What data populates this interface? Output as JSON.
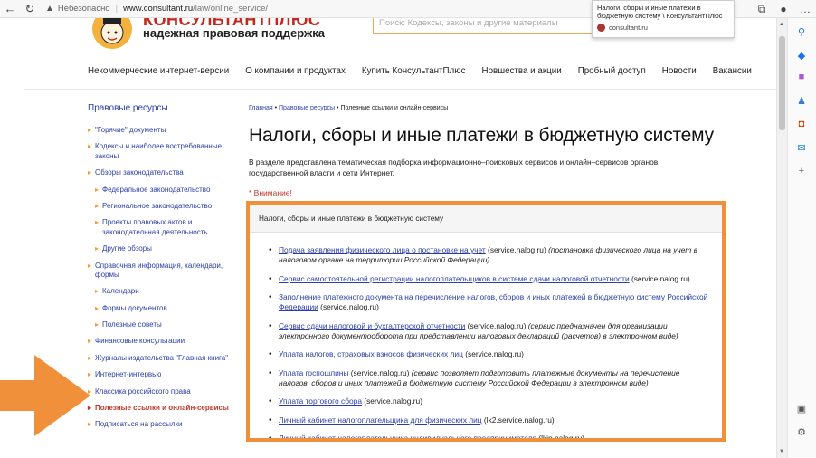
{
  "browser": {
    "insecure_label": "Небезопасно",
    "url_host": "www.consultant.ru",
    "url_path": "/law/online_service/",
    "tooltip_title": "Налоги, сборы и иные платежи в бюджетную систему \\ КонсультантПлюс",
    "tooltip_site": "consultant.ru"
  },
  "header": {
    "logo_title": "КОНСУЛЬТАНТПЛЮС",
    "logo_sub": "надежная правовая поддержка",
    "search_placeholder": "Поиск: Кодексы, законы и другие материалы"
  },
  "topnav": [
    "Некоммерческие интернет-версии",
    "О компании и продуктах",
    "Купить КонсультантПлюс",
    "Новшества и акции",
    "Пробный доступ",
    "Новости",
    "Вакансии"
  ],
  "sidebar": {
    "title": "Правовые ресурсы",
    "items": [
      {
        "label": "\"Горячие\" документы",
        "sub": false,
        "active": false
      },
      {
        "label": "Кодексы и наиболее востребованные законы",
        "sub": false,
        "active": false
      },
      {
        "label": "Обзоры законодательства",
        "sub": false,
        "active": false
      },
      {
        "label": "Федеральное законодательство",
        "sub": true,
        "active": false
      },
      {
        "label": "Региональное законодательство",
        "sub": true,
        "active": false
      },
      {
        "label": "Проекты правовых актов и законодательная деятельность",
        "sub": true,
        "active": false
      },
      {
        "label": "Другие обзоры",
        "sub": true,
        "active": false
      },
      {
        "label": "Справочная информация, календари, формы",
        "sub": false,
        "active": false
      },
      {
        "label": "Календари",
        "sub": true,
        "active": false
      },
      {
        "label": "Формы документов",
        "sub": true,
        "active": false
      },
      {
        "label": "Полезные советы",
        "sub": true,
        "active": false
      },
      {
        "label": "Финансовые консультации",
        "sub": false,
        "active": false
      },
      {
        "label": "Журналы издательства \"Главная книга\"",
        "sub": false,
        "active": false
      },
      {
        "label": "Интернет-интервью",
        "sub": false,
        "active": false
      },
      {
        "label": "Классика российского права",
        "sub": false,
        "active": false
      },
      {
        "label": "Полезные ссылки и онлайн-сервисы",
        "sub": false,
        "active": true
      },
      {
        "label": "Подписаться на рассылки",
        "sub": false,
        "active": false
      }
    ]
  },
  "content": {
    "crumb_home": "Главная",
    "crumb_resources": "Правовые ресурсы",
    "crumb_current": "Полезные ссылки и онлайн-сервисы",
    "title": "Налоги, сборы и иные платежи в бюджетную систему",
    "intro": "В разделе представлена тематическая подборка информационно–поисковых сервисов и онлайн–сервисов органов государственной власти и сети Интернет.",
    "attention": "* Внимание!",
    "box_title": "Налоги, сборы и иные платежи в бюджетную систему",
    "links": [
      {
        "link": "Подача заявления физического лица о постановке на учет",
        "plain": " (service.nalog.ru) ",
        "note": "(постановка физического лица на учет в налоговом органе на территории Российской Федерации)"
      },
      {
        "link": "Сервис самостоятельной регистрации налогоплательщиков в системе сдачи налоговой отчетности",
        "plain": " (service.nalog.ru)",
        "note": ""
      },
      {
        "link": "Заполнение платежного документа на перечисление налогов, сборов и иных платежей в бюджетную систему Российской Федерации",
        "plain": " (service.nalog.ru)",
        "note": ""
      },
      {
        "link": "Сервис сдачи налоговой и бухгалтерской отчетности",
        "plain": " (service.nalog.ru) ",
        "note": "(сервис предназначен для организации электронного документооборота при представлении налоговых деклараций (расчетов) в электронном виде)"
      },
      {
        "link": "Уплата налогов, страховых взносов физических лиц",
        "plain": " (service.nalog.ru)",
        "note": ""
      },
      {
        "link": "Уплата госпошлины",
        "plain": " (service.nalog.ru) ",
        "note": "(сервис позволяет подготовить платежные документы на перечисление налогов, сборов и иных платежей в бюджетную систему Российской Федерации в электронном виде)"
      },
      {
        "link": "Уплата торгового сбора",
        "plain": " (service.nalog.ru)",
        "note": ""
      },
      {
        "link": "Личный кабинет налогоплательщика для физических лиц",
        "plain": " (lk2.service.nalog.ru)",
        "note": ""
      },
      {
        "link": "Личный кабинет налогоплательщика индивидуального предпринимателя",
        "plain": " (lkip.nalog.ru)",
        "note": ""
      }
    ]
  },
  "colors": {
    "link": "#2a3ea8",
    "accent": "#f0903a",
    "active": "#c0392b"
  }
}
